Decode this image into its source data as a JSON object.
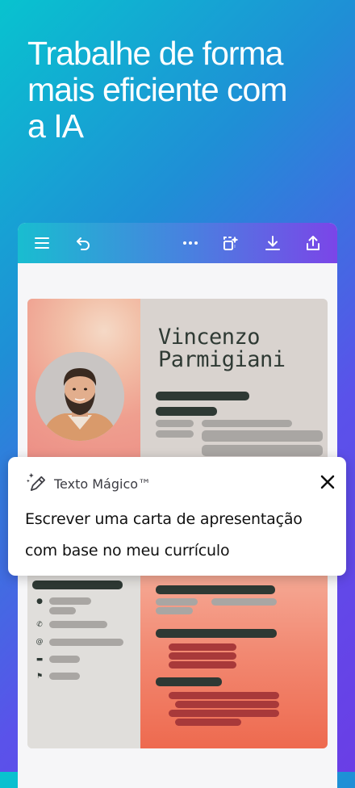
{
  "headline": {
    "line1": "Trabalhe de forma",
    "line2": "mais eficiente com",
    "line3": "a IA"
  },
  "toolbar": {
    "icons": [
      "menu-icon",
      "undo-icon",
      "more-icon",
      "magic-resize-icon",
      "download-icon",
      "share-icon"
    ]
  },
  "resume": {
    "first_name": "Vincenzo",
    "last_name": "Parmigiani"
  },
  "contact_icons": [
    "location-icon",
    "phone-icon",
    "email-icon",
    "briefcase-icon",
    "flag-icon"
  ],
  "magic_card": {
    "title": "Texto Mágico™",
    "body_line1": "Escrever uma carta de apresentação",
    "body_line2": "com base no meu currículo"
  },
  "colors": {
    "accent_teal": "#08c3cf",
    "accent_purple": "#6a3ee6",
    "resume_dark": "#2e3934",
    "resume_red": "#a8393a"
  }
}
